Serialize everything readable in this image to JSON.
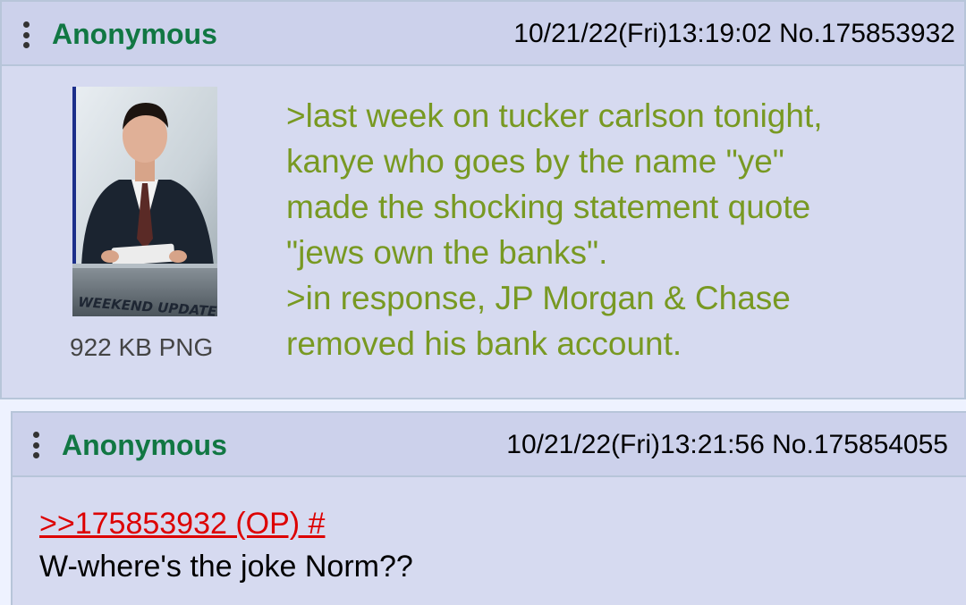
{
  "op": {
    "name": "Anonymous",
    "datetime": "10/21/22(Fri)13:19:02",
    "post_number": "No.175853932",
    "file_info": "922 KB PNG",
    "thumbnail_label": "WEEKEND UPDATE",
    "lines": [
      ">last week on tucker carlson tonight,",
      "kanye who goes by the name \"ye\"",
      "made the shocking statement quote",
      "\"jews own the banks\".",
      ">in response, JP Morgan & Chase",
      "removed his bank account."
    ]
  },
  "reply": {
    "name": "Anonymous",
    "datetime": "10/21/22(Fri)13:21:56",
    "post_number": "No.175854055",
    "quote_link": ">>175853932 (OP) #",
    "text": "W-where's the joke Norm??"
  },
  "colors": {
    "post_bg": "#d6daf0",
    "header_bg": "#ccd1eb",
    "border": "#b7c5d9",
    "name": "#117743",
    "greentext": "#789922",
    "quotelink": "#dd0000"
  }
}
